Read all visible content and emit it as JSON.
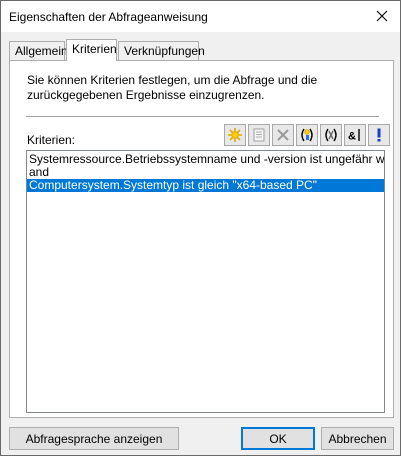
{
  "window": {
    "title": "Eigenschaften der Abfrageanweisung"
  },
  "tabs": [
    {
      "label": "Allgemein",
      "active": false
    },
    {
      "label": "Kriterien",
      "active": true
    },
    {
      "label": "Verknüpfungen",
      "active": false
    }
  ],
  "panel": {
    "description": "Sie können Kriterien festlegen, um die Abfrage und die zurückgegebenen Ergebnisse einzugrenzen.",
    "criteria_label": "Kriterien:"
  },
  "toolbar": {
    "buttons": [
      {
        "icon": "new-criterion-icon",
        "enabled": true
      },
      {
        "icon": "properties-icon",
        "enabled": false
      },
      {
        "icon": "delete-icon",
        "enabled": false
      },
      {
        "icon": "insert-parenthesis-icon",
        "enabled": true
      },
      {
        "icon": "remove-parenthesis-icon",
        "enabled": true
      },
      {
        "icon": "and-or-icon",
        "enabled": true
      },
      {
        "icon": "not-icon",
        "enabled": true
      }
    ]
  },
  "criteria": [
    {
      "text": "Systemressource.Betriebssystemname und -version ist ungefähr wie \"%Work",
      "selected": false
    },
    {
      "text": "and",
      "selected": false
    },
    {
      "text": "Computersystem.Systemtyp ist gleich \"x64-based PC\"",
      "selected": true
    }
  ],
  "buttons": {
    "show_query_language": "Abfragesprache anzeigen",
    "ok": "OK",
    "cancel": "Abbrechen"
  },
  "colors": {
    "selection": "#0078d7",
    "default_button_border": "#0078d7"
  }
}
